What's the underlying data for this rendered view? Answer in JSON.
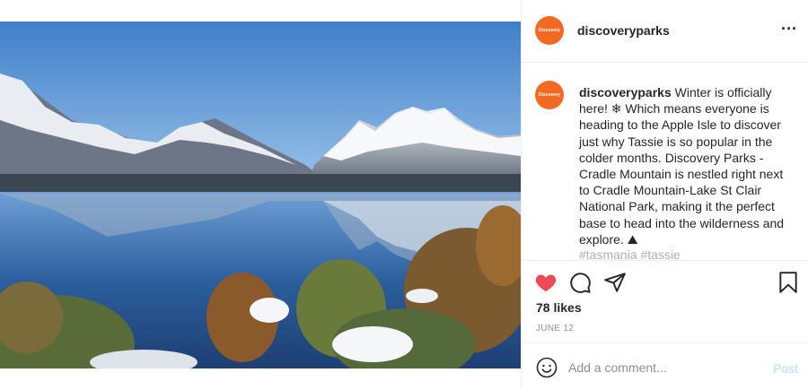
{
  "post": {
    "image_alt": "Cradle Mountain reflected in Dove Lake in winter",
    "account": {
      "username": "discoveryparks",
      "logo_text": "Discovery"
    },
    "caption": {
      "username": "discoveryparks",
      "text": " Winter is officially here! ❄ Which means everyone is heading to the Apple Isle to discover just why Tassie is so popular in the colder months. Discovery Parks - Cradle Mountain is nestled right next to Cradle Mountain-Lake St Clair National Park, making it the perfect base to head into the wilderness and explore. ⛰",
      "hashtags_partial": "#tasmania #tassie"
    },
    "more_icon": "more-horizontal-icon",
    "actions": {
      "like_icon": "heart-filled-icon",
      "comment_icon": "comment-bubble-icon",
      "share_icon": "paper-plane-icon",
      "save_icon": "bookmark-icon",
      "like_color": "#ed4956"
    },
    "likes": "78 likes",
    "date": "JUNE 12",
    "comment_box": {
      "emoji_icon": "smiley-icon",
      "placeholder": "Add a comment...",
      "post_label": "Post",
      "post_color": "#b2dffc"
    }
  }
}
